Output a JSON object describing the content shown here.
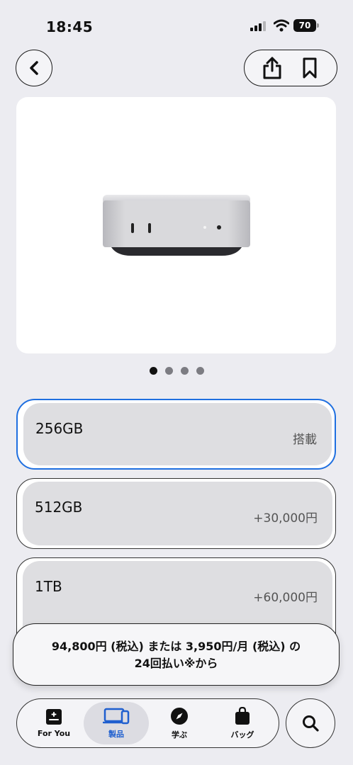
{
  "status_bar": {
    "time": "18:45",
    "battery": "70"
  },
  "product_image": {
    "alt": "Mac mini",
    "page_count": 4,
    "active_page": 1
  },
  "options": [
    {
      "name": "256GB",
      "price": "搭載",
      "selected": true
    },
    {
      "name": "512GB",
      "price": "+30,000円",
      "selected": false
    },
    {
      "name": "1TB",
      "price": "+60,000円",
      "selected": false
    }
  ],
  "price_summary": {
    "line1": "94,800円 (税込) または 3,950円/月 (税込) の",
    "line2": "24回払い※から"
  },
  "tab_bar": {
    "tabs": [
      {
        "label": "For You",
        "icon": "for-you-icon"
      },
      {
        "label": "製品",
        "icon": "products-icon",
        "active": true
      },
      {
        "label": "学ぶ",
        "icon": "compass-icon"
      },
      {
        "label": "バッグ",
        "icon": "bag-icon"
      }
    ]
  },
  "colors": {
    "accent": "#1f6fe0",
    "background": "#ececf1"
  }
}
